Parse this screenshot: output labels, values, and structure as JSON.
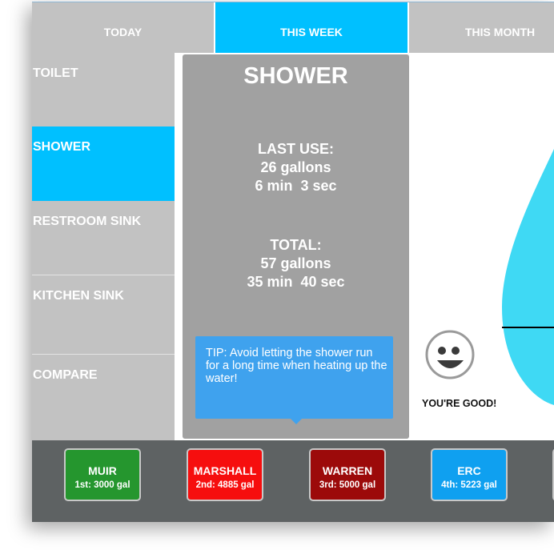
{
  "tabs": [
    {
      "label": "TODAY",
      "active": false
    },
    {
      "label": "THIS WEEK",
      "active": true
    },
    {
      "label": "THIS MONTH",
      "active": false
    }
  ],
  "sidebar": {
    "items": [
      {
        "label": "TOILET",
        "active": false
      },
      {
        "label": "SHOWER",
        "active": true
      },
      {
        "label": "RESTROOM SINK",
        "active": false
      },
      {
        "label": "KITCHEN SINK",
        "active": false
      },
      {
        "label": "COMPARE",
        "active": false
      }
    ]
  },
  "panel": {
    "title": "SHOWER",
    "last_use_heading": "LAST USE:",
    "last_use_gallons": "26 gallons",
    "last_use_time": "6 min  3 sec",
    "total_heading": "TOTAL:",
    "total_gallons": "57 gallons",
    "total_time": "35 min  40 sec",
    "tip": "TIP: Avoid letting the shower run for a long time when heating up the water!"
  },
  "status": {
    "label": "YOU'RE GOOD!",
    "icon": "smiley-face-icon"
  },
  "teams": [
    {
      "name": "MUIR",
      "rank": "1st: 3000 gal",
      "color": "#25962e"
    },
    {
      "name": "MARSHALL",
      "rank": "2nd: 4885 gal",
      "color": "#f60e0e"
    },
    {
      "name": "WARREN",
      "rank": "3rd: 5000 gal",
      "color": "#9c0a0a"
    },
    {
      "name": "ERC",
      "rank": "4th: 5223 gal",
      "color": "#0fa0f0"
    }
  ],
  "colors": {
    "accent": "#00c0ff",
    "water_drop": "#3fd9f4",
    "tip_bg": "#3fa2ee",
    "panel_bg": "#a1a1a1",
    "sidebar_bg": "#c2c2c2",
    "footer_bg": "#5e6263"
  }
}
